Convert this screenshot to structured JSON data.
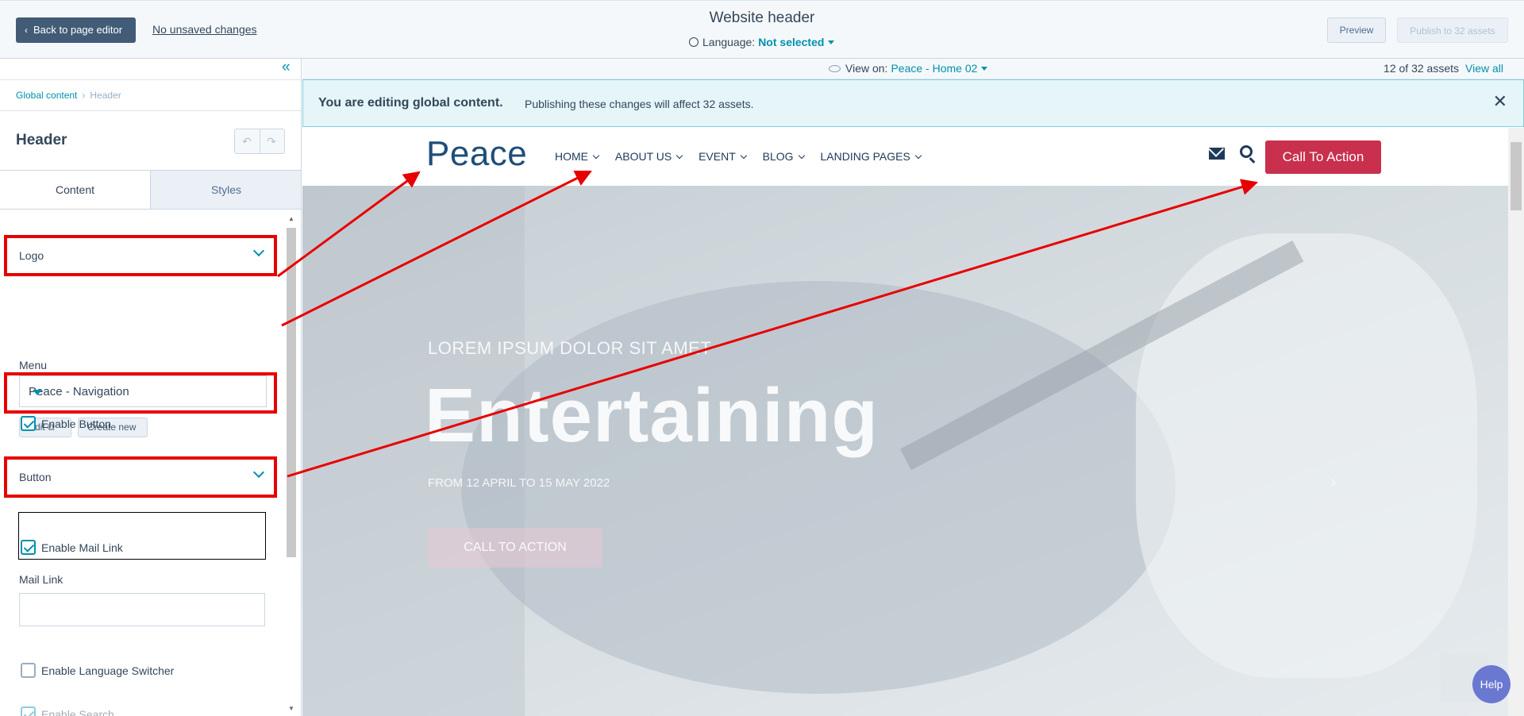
{
  "topbar": {
    "back_label": "Back to page editor",
    "unsaved_label": "No unsaved changes",
    "title": "Website header",
    "language_label": "Language:",
    "language_value": "Not selected",
    "preview_label": "Preview",
    "publish_label": "Publish to 32 assets"
  },
  "sidebar": {
    "breadcrumb": [
      "Global content",
      "Header"
    ],
    "title": "Header",
    "tabs": [
      {
        "label": "Content",
        "active": true
      },
      {
        "label": "Styles",
        "active": false
      }
    ],
    "logo_label": "Logo",
    "menu_label": "Menu",
    "menu_value": "Peace - Navigation",
    "edit_label": "Edit",
    "create_new_label": "Create new",
    "enable_button_label": "Enable Button",
    "button_label": "Button",
    "enable_mail_link_label": "Enable Mail Link",
    "mail_link_label": "Mail Link",
    "mail_link_value": "",
    "enable_language_switcher_label": "Enable Language Switcher",
    "enable_search_label": "Enable Search"
  },
  "viewbar": {
    "view_on_label": "View on:",
    "view_on_value": "Peace - Home 02",
    "assets_count": "12 of 32 assets",
    "view_all_label": "View all"
  },
  "banner": {
    "bold": "You are editing global content.",
    "text": "Publishing these changes will affect 32 assets."
  },
  "site": {
    "brand": "Peace",
    "nav": [
      "HOME",
      "ABOUT US",
      "EVENT",
      "BLOG",
      "LANDING PAGES"
    ],
    "cta": "Call To Action",
    "hero_sub": "LOREM IPSUM DOLOR SIT AMET",
    "hero_heading": "Entertaining",
    "hero_date": "FROM 12 APRIL TO 15 MAY 2022",
    "hero_cta": "CALL TO ACTION"
  },
  "help_label": "Help",
  "colors": {
    "accent": "#0091ae",
    "annotation": "#e80000",
    "cta": "#c8304d",
    "brand": "#1f4e79"
  }
}
